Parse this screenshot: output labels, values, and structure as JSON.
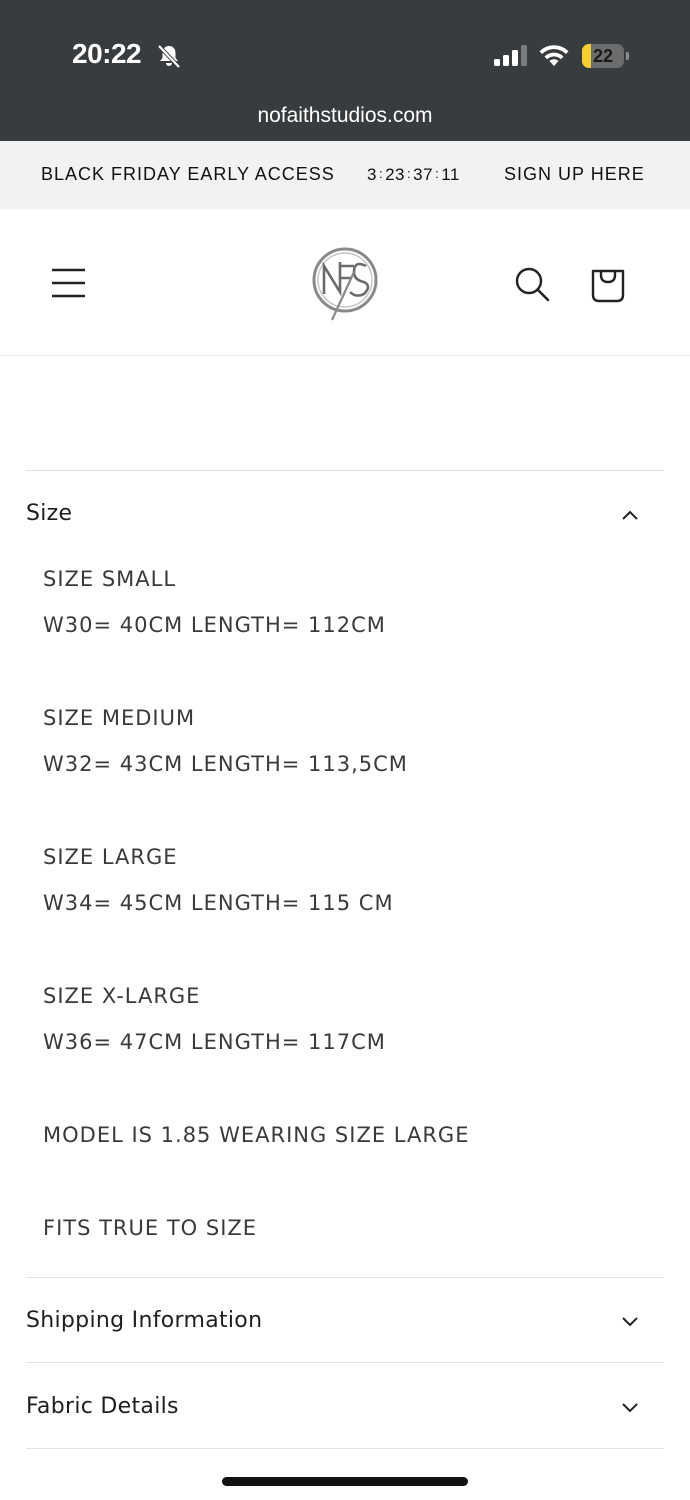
{
  "status_bar": {
    "time": "20:22",
    "battery": "22",
    "battery_level": 0.22
  },
  "browser": {
    "url": "nofaithstudios.com"
  },
  "announcement": {
    "text": "BLACK FRIDAY EARLY ACCESS",
    "countdown": {
      "days": "3",
      "hours": "23",
      "minutes": "37",
      "seconds": "11"
    },
    "cta": "SIGN UP HERE"
  },
  "header": {
    "logo_text": "NFS"
  },
  "accordions": [
    {
      "title": "Size",
      "expanded": true,
      "lines": [
        "SIZE SMALL",
        "W30= 40CM LENGTH= 112CM",
        "SIZE MEDIUM",
        "W32= 43CM LENGTH= 113,5CM",
        "SIZE LARGE",
        "W34= 45CM LENGTH= 115 CM",
        "SIZE X-LARGE",
        "W36= 47CM LENGTH= 117CM",
        "MODEL IS 1.85 WEARING SIZE LARGE",
        "FITS TRUE TO SIZE"
      ]
    },
    {
      "title": "Shipping Information",
      "expanded": false
    },
    {
      "title": "Fabric Details",
      "expanded": false
    }
  ],
  "colors": {
    "chrome": "#393c3e",
    "announcement_bg": "#f2f2f2",
    "battery": "#f5cf2e"
  }
}
